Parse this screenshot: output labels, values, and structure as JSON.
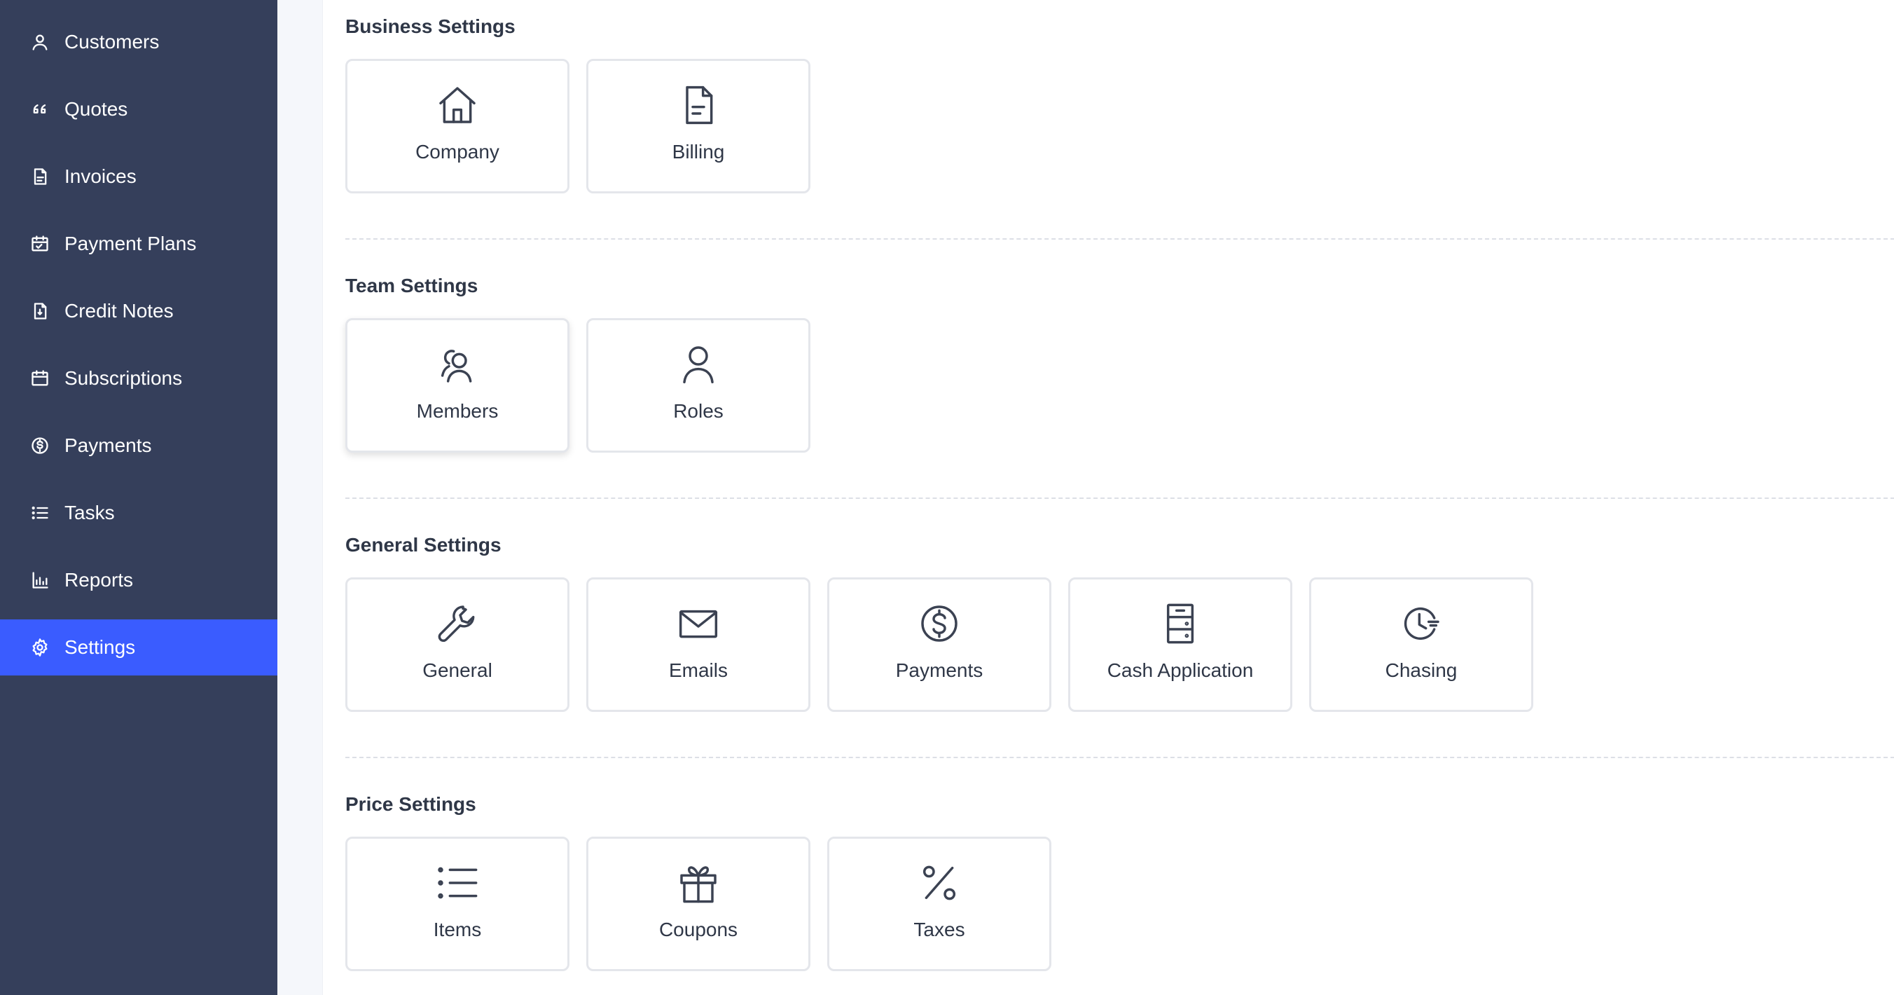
{
  "sidebar": {
    "items": [
      {
        "label": "Customers",
        "icon": "user-icon",
        "active": false
      },
      {
        "label": "Quotes",
        "icon": "quote-icon",
        "active": false
      },
      {
        "label": "Invoices",
        "icon": "document-icon",
        "active": false
      },
      {
        "label": "Payment Plans",
        "icon": "calendar-check-icon",
        "active": false
      },
      {
        "label": "Credit Notes",
        "icon": "credit-note-icon",
        "active": false
      },
      {
        "label": "Subscriptions",
        "icon": "calendar-icon",
        "active": false
      },
      {
        "label": "Payments",
        "icon": "dollar-circle-icon",
        "active": false
      },
      {
        "label": "Tasks",
        "icon": "list-icon",
        "active": false
      },
      {
        "label": "Reports",
        "icon": "bar-chart-icon",
        "active": false
      },
      {
        "label": "Settings",
        "icon": "gear-icon",
        "active": true
      }
    ],
    "active_color": "#3a5cff",
    "background": "#353f5b"
  },
  "sections": [
    {
      "title": "Business Settings",
      "cards": [
        {
          "label": "Company",
          "icon": "house-icon"
        },
        {
          "label": "Billing",
          "icon": "document-icon"
        }
      ]
    },
    {
      "title": "Team Settings",
      "cards": [
        {
          "label": "Members",
          "icon": "users-icon"
        },
        {
          "label": "Roles",
          "icon": "user-icon"
        }
      ]
    },
    {
      "title": "General Settings",
      "cards": [
        {
          "label": "General",
          "icon": "wrench-icon"
        },
        {
          "label": "Emails",
          "icon": "envelope-icon"
        },
        {
          "label": "Payments",
          "icon": "dollar-circle-icon"
        },
        {
          "label": "Cash Application",
          "icon": "cabinet-icon"
        },
        {
          "label": "Chasing",
          "icon": "clock-icon"
        }
      ]
    },
    {
      "title": "Price Settings",
      "cards": [
        {
          "label": "Items",
          "icon": "list-icon"
        },
        {
          "label": "Coupons",
          "icon": "gift-icon"
        },
        {
          "label": "Taxes",
          "icon": "percent-icon"
        }
      ]
    }
  ]
}
